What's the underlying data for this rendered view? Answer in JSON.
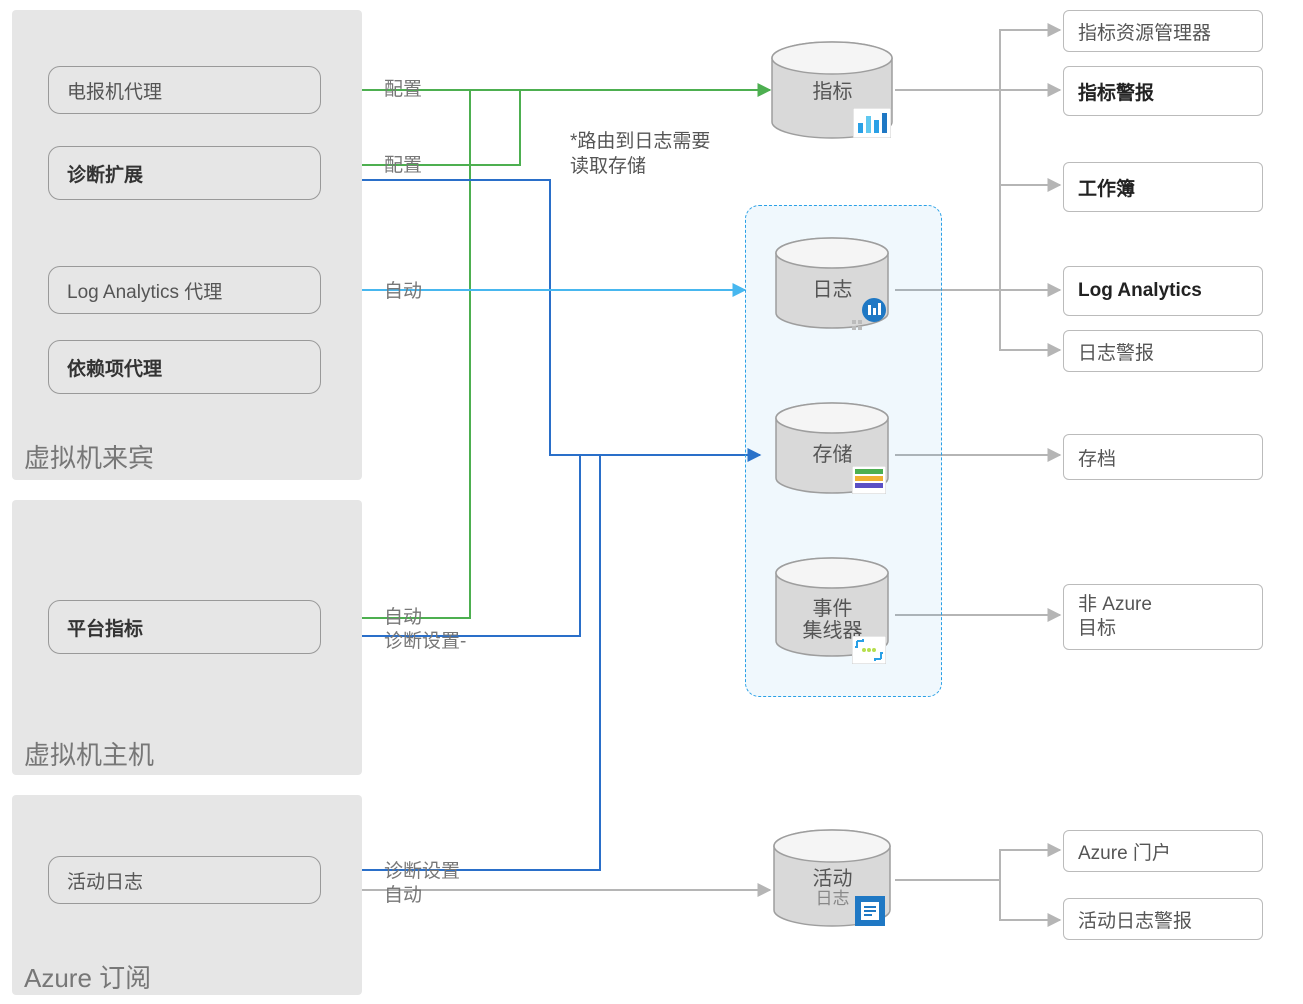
{
  "panels": {
    "guest": {
      "title": "虚拟机来宾"
    },
    "host": {
      "title": "虚拟机主机"
    },
    "sub": {
      "title": "Azure 订阅"
    }
  },
  "sources": {
    "telegraf": {
      "label": "电报机代理"
    },
    "diagext": {
      "label": "诊断扩展"
    },
    "laagent": {
      "label": "Log Analytics 代理"
    },
    "depagent": {
      "label": "依赖项代理"
    },
    "platmetrics": {
      "label": "平台指标"
    },
    "activity": {
      "label": "活动日志"
    }
  },
  "edge_labels": {
    "telegraf_cfg": "配置",
    "diagext_cfg": "配置",
    "la_auto": "自动",
    "route_note_1": "*路由到日志需要",
    "route_note_2": "读取存储",
    "plat_auto": "自动",
    "plat_diag": "诊断设置-",
    "act_diag": "诊断设置",
    "act_auto": "自动"
  },
  "stores": {
    "metrics": {
      "label": "指标"
    },
    "logs": {
      "label": "日志"
    },
    "storage": {
      "label": "存储"
    },
    "eventhub": {
      "label1": "事件",
      "label2": "集线器"
    },
    "activity": {
      "label1": "活动",
      "label2": "日志"
    }
  },
  "dests": {
    "metrics_explorer": "指标资源管理器",
    "metric_alerts": "指标警报",
    "workbooks": "工作簿",
    "log_analytics": "Log Analytics",
    "log_alerts": "日志警报",
    "archive": "存档",
    "non_azure": "非 Azure\n目标",
    "portal": "Azure 门户",
    "activity_alerts": "活动日志警报"
  },
  "colors": {
    "green": "#4daf50",
    "blue": "#2a6fc9",
    "lblue": "#47b7ef",
    "gray": "#b5b5b5",
    "cylTop": "#f5f5f5",
    "cylBody": "#d9d9d9",
    "cylEdge": "#9e9e9e"
  }
}
